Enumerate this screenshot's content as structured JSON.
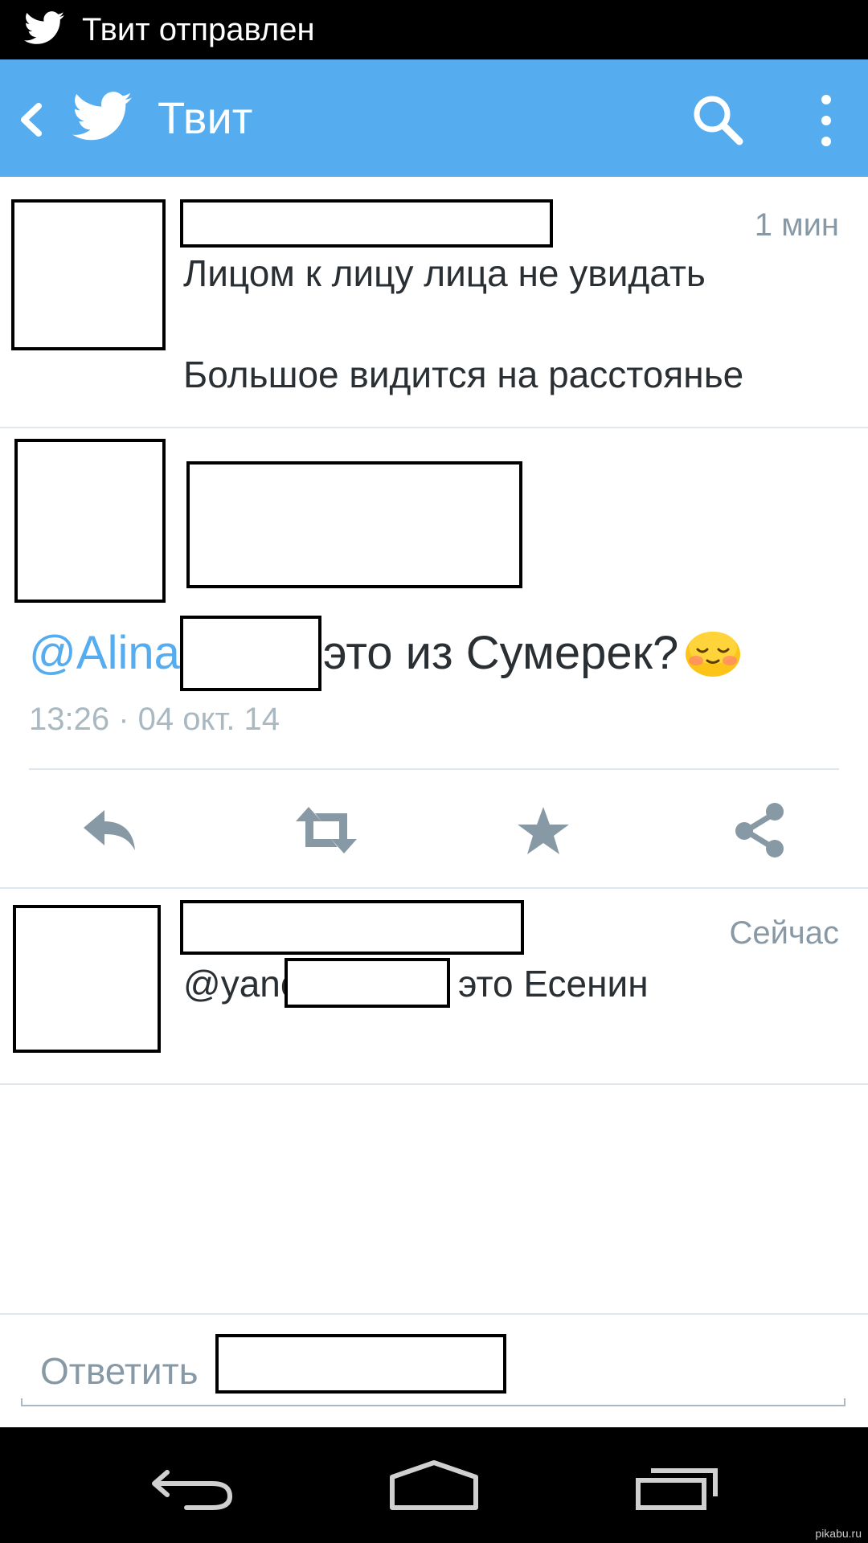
{
  "status_bar": {
    "notification_text": "Твит отправлен",
    "notification_icon": "twitter-bird-icon"
  },
  "app_bar": {
    "title": "Твит",
    "background_color": "#55acee",
    "icons": [
      "back-icon",
      "twitter-bird-icon",
      "search-icon",
      "overflow-menu-icon"
    ]
  },
  "tweets": [
    {
      "time": "1 мин",
      "lines": [
        "Лицом к лицу лица не увидать",
        "Большое видится на расстоянье"
      ]
    },
    {
      "mention": "@Alina",
      "text": "это из Сумерек?",
      "emoji": "smiling-face-with-blush",
      "timestamp": "13:26 · 04 окт. 14",
      "actions": [
        "reply-icon",
        "retweet-icon",
        "favorite-icon",
        "share-icon"
      ]
    },
    {
      "time": "Сейчас",
      "mention": "@yanc",
      "text": "это Есенин"
    }
  ],
  "reply_bar": {
    "placeholder": "Ответить"
  },
  "nav_bar": {
    "icons": [
      "nav-back-icon",
      "nav-home-icon",
      "nav-recents-icon"
    ]
  },
  "watermark": "pikabu.ru",
  "colors": {
    "accent": "#55acee",
    "icon_gray": "#8899a6",
    "text": "#292f33"
  }
}
